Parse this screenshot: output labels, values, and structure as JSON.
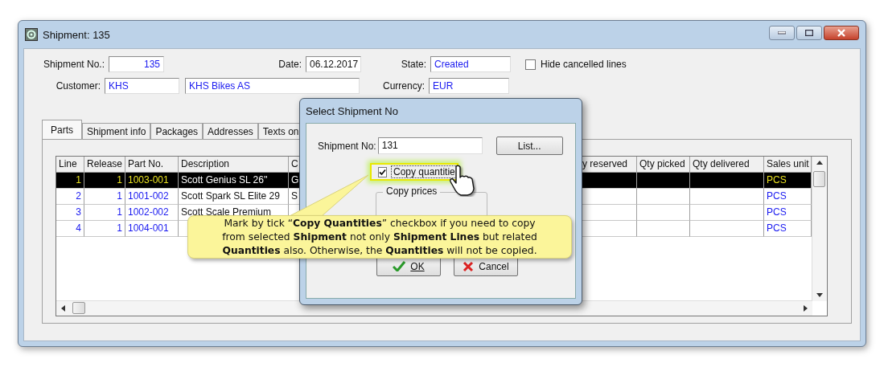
{
  "window": {
    "title": "Shipment: 135"
  },
  "header": {
    "shipment_no_label": "Shipment No.:",
    "shipment_no": "135",
    "date_label": "Date:",
    "date": "06.12.2017",
    "state_label": "State:",
    "state": "Created",
    "hide_cancelled": {
      "label": "Hide cancelled lines",
      "checked": false
    },
    "customer_label": "Customer:",
    "customer_code": "KHS",
    "customer_name": "KHS Bikes AS",
    "currency_label": "Currency:",
    "currency": "EUR"
  },
  "tabs": [
    {
      "label": "Parts",
      "selected": true
    },
    {
      "label": "Shipment info",
      "selected": false
    },
    {
      "label": "Packages",
      "selected": false
    },
    {
      "label": "Addresses",
      "selected": false
    },
    {
      "label": "Texts on",
      "selected": false
    }
  ],
  "table": {
    "columns": [
      "Line",
      "Release",
      "Part No.",
      "Description",
      "C",
      "y reserved",
      "Qty picked",
      "Qty delivered",
      "Sales unit"
    ],
    "rows": [
      {
        "selected": true,
        "cells": [
          "1",
          "1",
          "1003-001",
          "Scott Genius SL 26''",
          "G",
          "",
          "",
          "",
          "PCS"
        ]
      },
      {
        "selected": false,
        "cells": [
          "2",
          "1",
          "1001-002",
          "Scott Spark SL Elite 29",
          "S",
          "",
          "",
          "",
          "PCS"
        ]
      },
      {
        "selected": false,
        "cells": [
          "3",
          "1",
          "1002-002",
          "Scott Scale Premium",
          "",
          "",
          "",
          "",
          "PCS"
        ]
      },
      {
        "selected": false,
        "cells": [
          "4",
          "1",
          "1004-001",
          "",
          "",
          "",
          "",
          "",
          "PCS"
        ]
      }
    ]
  },
  "dialog": {
    "title": "Select Shipment No",
    "shipment_no_label": "Shipment No:",
    "shipment_no": "131",
    "list_button": "List...",
    "copy_quantities": {
      "label": "Copy quantitie",
      "checked": true
    },
    "copy_prices_label": "Copy prices",
    "ok_button": "OK",
    "cancel_button": "Cancel"
  },
  "callout": {
    "text": "Mark by tick “**Copy Quantities**” checkbox if you need to copy\nfrom selected **Shipment** not only **Shipment Lines** but related\n**Quantities** also.  Otherwise, the **Quantities** will not be copied."
  }
}
